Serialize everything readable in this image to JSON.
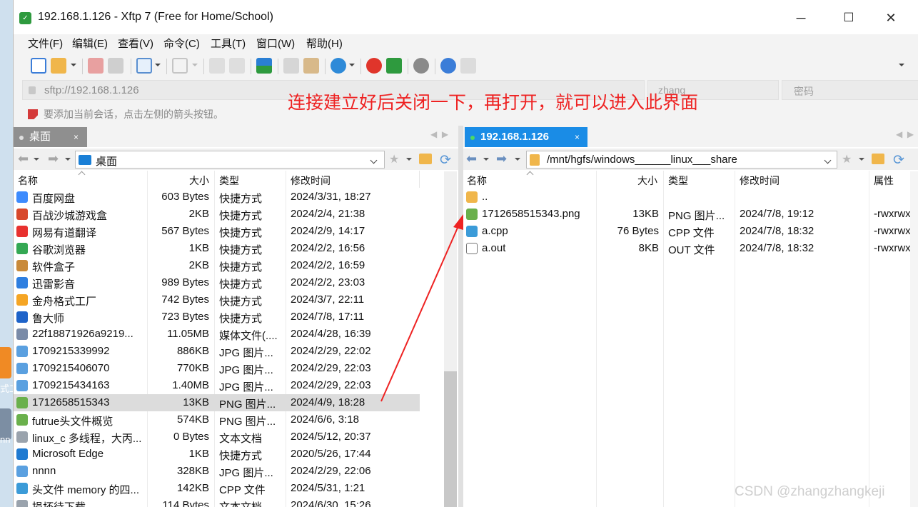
{
  "desktop": {
    "label_a": "式工",
    "label_b": "nn"
  },
  "window": {
    "title": "192.168.1.126 - Xftp 7 (Free for Home/School)",
    "minimize": "─",
    "maximize": "☐",
    "close": "✕"
  },
  "menu": [
    "文件(F)",
    "编辑(E)",
    "查看(V)",
    "命令(C)",
    "工具(T)",
    "窗口(W)",
    "帮助(H)"
  ],
  "address": {
    "url": "sftp://192.168.1.126",
    "username": "zhang",
    "password_placeholder": "密码"
  },
  "hint": "要添加当前会话，点击左侧的箭头按钮。",
  "annotation": "连接建立好后关闭一下，再打开，就可以进入此界面",
  "annotation_color": "#ee2222",
  "left_pane": {
    "tab": "桌面",
    "tab_close": "×",
    "path": "桌面",
    "columns": {
      "name": "名称",
      "size": "大小",
      "type": "类型",
      "modified": "修改时间"
    },
    "files": [
      {
        "name": "百度网盘",
        "size": "603 Bytes",
        "type": "快捷方式",
        "modified": "2024/3/31, 18:27",
        "icon": "baidu-netdisk-icon",
        "color": "#3d8bfd"
      },
      {
        "name": "百战沙城游戏盒",
        "size": "2KB",
        "type": "快捷方式",
        "modified": "2024/2/4, 21:38",
        "icon": "game-box-icon",
        "color": "#d8482b"
      },
      {
        "name": "网易有道翻译",
        "size": "567 Bytes",
        "type": "快捷方式",
        "modified": "2024/2/9, 14:17",
        "icon": "youdao-icon",
        "color": "#e8312f"
      },
      {
        "name": "谷歌浏览器",
        "size": "1KB",
        "type": "快捷方式",
        "modified": "2024/2/2, 16:56",
        "icon": "chrome-icon",
        "color": "#34a853"
      },
      {
        "name": "软件盒子",
        "size": "2KB",
        "type": "快捷方式",
        "modified": "2024/2/2, 16:59",
        "icon": "software-box-icon",
        "color": "#c98a3a"
      },
      {
        "name": "迅雷影音",
        "size": "989 Bytes",
        "type": "快捷方式",
        "modified": "2024/2/2, 23:03",
        "icon": "xunlei-icon",
        "color": "#2f7fe0"
      },
      {
        "name": "金舟格式工厂",
        "size": "742 Bytes",
        "type": "快捷方式",
        "modified": "2024/3/7, 22:11",
        "icon": "format-factory-icon",
        "color": "#f5a524"
      },
      {
        "name": "鲁大师",
        "size": "723 Bytes",
        "type": "快捷方式",
        "modified": "2024/7/8, 17:11",
        "icon": "ludashi-icon",
        "color": "#1e63c9"
      },
      {
        "name": "22f18871926a9219...",
        "size": "11.05MB",
        "type": "媒体文件(....",
        "modified": "2024/4/28, 16:39",
        "icon": "media-file-icon",
        "color": "#7a8ba8"
      },
      {
        "name": "1709215339992",
        "size": "886KB",
        "type": "JPG 图片...",
        "modified": "2024/2/29, 22:02",
        "icon": "jpg-file-icon",
        "color": "#5aa0e0"
      },
      {
        "name": "1709215406070",
        "size": "770KB",
        "type": "JPG 图片...",
        "modified": "2024/2/29, 22:03",
        "icon": "jpg-file-icon",
        "color": "#5aa0e0"
      },
      {
        "name": "1709215434163",
        "size": "1.40MB",
        "type": "JPG 图片...",
        "modified": "2024/2/29, 22:03",
        "icon": "jpg-file-icon",
        "color": "#5aa0e0"
      },
      {
        "name": "1712658515343",
        "size": "13KB",
        "type": "PNG 图片...",
        "modified": "2024/4/9, 18:28",
        "icon": "png-file-icon",
        "color": "#6ab04c",
        "selected": true
      },
      {
        "name": "futrue头文件概览",
        "size": "574KB",
        "type": "PNG 图片...",
        "modified": "2024/6/6, 3:18",
        "icon": "png-file-icon",
        "color": "#6ab04c"
      },
      {
        "name": "linux_c 多线程，大丙...",
        "size": "0 Bytes",
        "type": "文本文档",
        "modified": "2024/5/12, 20:37",
        "icon": "text-file-icon",
        "color": "#9aa3ad"
      },
      {
        "name": "Microsoft Edge",
        "size": "1KB",
        "type": "快捷方式",
        "modified": "2020/5/26, 17:44",
        "icon": "edge-icon",
        "color": "#1f7ad1"
      },
      {
        "name": "nnnn",
        "size": "328KB",
        "type": "JPG 图片...",
        "modified": "2024/2/29, 22:06",
        "icon": "jpg-file-icon",
        "color": "#5aa0e0"
      },
      {
        "name": "头文件 memory 的四...",
        "size": "142KB",
        "type": "CPP 文件",
        "modified": "2024/5/31, 1:21",
        "icon": "cpp-file-icon",
        "color": "#3b9bd8"
      },
      {
        "name": "损坏待下载",
        "size": "114 Bytes",
        "type": "文本文档",
        "modified": "2024/6/30, 15:26",
        "icon": "text-file-icon",
        "color": "#9aa3ad"
      }
    ]
  },
  "right_pane": {
    "tab": "192.168.1.126",
    "tab_close": "×",
    "path": "/mnt/hgfs/windows______linux___share",
    "columns": {
      "name": "名称",
      "size": "大小",
      "type": "类型",
      "modified": "修改时间",
      "attr": "属性"
    },
    "files": [
      {
        "name": "..",
        "size": "",
        "type": "",
        "modified": "",
        "attr": "",
        "icon": "parent-folder-icon",
        "color": "#f0b64b"
      },
      {
        "name": "1712658515343.png",
        "size": "13KB",
        "type": "PNG 图片...",
        "modified": "2024/7/8, 19:12",
        "attr": "-rwxrwx",
        "icon": "png-file-icon",
        "color": "#6ab04c"
      },
      {
        "name": "a.cpp",
        "size": "76 Bytes",
        "type": "CPP 文件",
        "modified": "2024/7/8, 18:32",
        "attr": "-rwxrwx",
        "icon": "cpp-file-icon",
        "color": "#3b9bd8"
      },
      {
        "name": "a.out",
        "size": "8KB",
        "type": "OUT 文件",
        "modified": "2024/7/8, 18:32",
        "attr": "-rwxrwx",
        "icon": "file-icon",
        "color": "#ffffff"
      }
    ]
  },
  "watermark": "CSDN @zhangzhangkeji"
}
